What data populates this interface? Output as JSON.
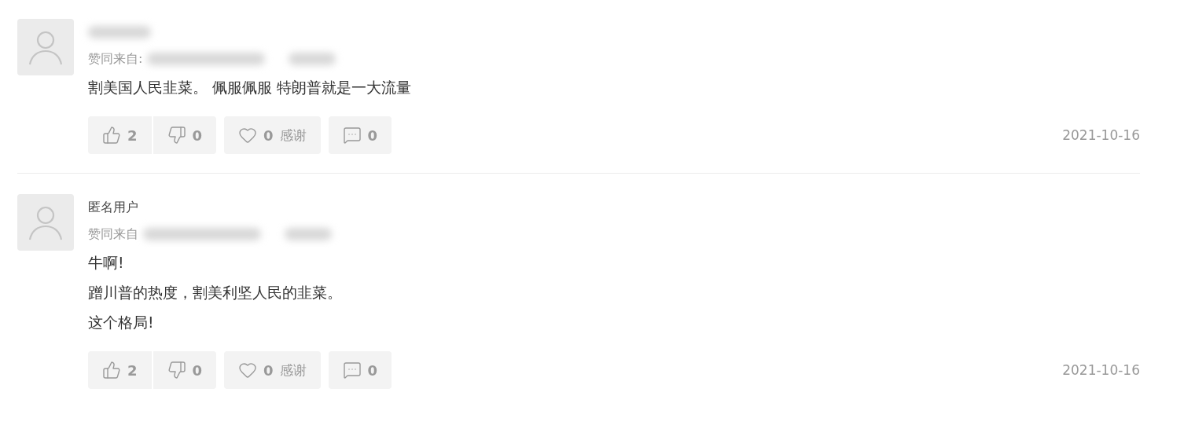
{
  "comments": [
    {
      "author_blurred": true,
      "endorse_label": "赞同来自:",
      "body": [
        "割美国人民韭菜。 佩服佩服  特朗普就是一大流量"
      ],
      "likes": "2",
      "dislikes": "0",
      "thanks": "0",
      "thanks_label": "感谢",
      "replies": "0",
      "date": "2021-10-16"
    },
    {
      "author_blurred": false,
      "author": "匿名用户",
      "endorse_label": "赞同来自",
      "body": [
        "牛啊!",
        "蹭川普的热度，割美利坚人民的韭菜。",
        "这个格局!"
      ],
      "likes": "2",
      "dislikes": "0",
      "thanks": "0",
      "thanks_label": "感谢",
      "replies": "0",
      "date": "2021-10-16"
    }
  ]
}
